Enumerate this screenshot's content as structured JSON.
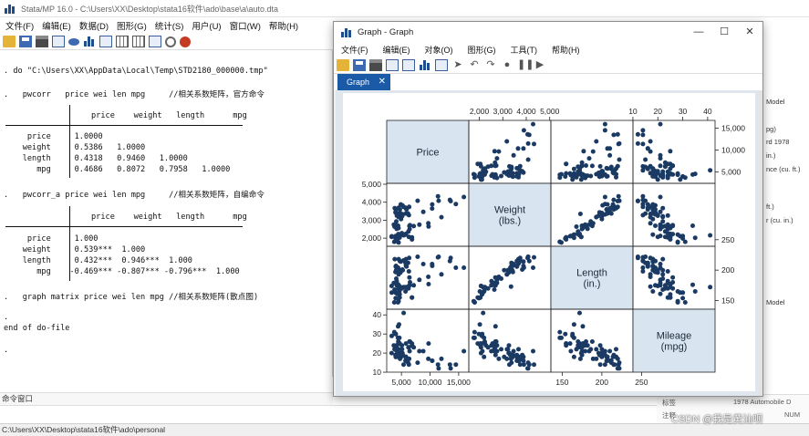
{
  "main_window": {
    "title": "Stata/MP 16.0 - C:\\Users\\XX\\Desktop\\stata16软件\\ado\\base\\a\\auto.dta",
    "menu": [
      "文件(F)",
      "编辑(E)",
      "数据(D)",
      "图形(G)",
      "统计(S)",
      "用户(U)",
      "窗口(W)",
      "帮助(H)"
    ]
  },
  "results": {
    "lines": [
      ". do \"C:\\Users\\XX\\AppData\\Local\\Temp\\STD2180_000000.tmp\"",
      ".   pwcorr   price wei len mpg     //相关系数矩阵，官方命令",
      "price    weight   length      mpg",
      "     price     1.0000",
      "    weight     0.5386   1.0000",
      "    length     0.4318   0.9460   1.0000",
      "       mpg     0.4686   0.8072   0.7958   1.0000",
      ".   pwcorr_a price wei len mpg     //相关系数矩阵，自编命令",
      "price    weight   length      mpg",
      "     price     1.000",
      "    weight     0.539***  1.000",
      "    length     0.432***  0.946***  1.000",
      "       mpg    -0.469*** -0.807*** -0.796***  1.000",
      ".   graph matrix price wei len mpg //相关系数矩阵(散点图)",
      ".",
      "end of do-file",
      "."
    ]
  },
  "command_window_label": "命令窗口",
  "statusbar": "C:\\Users\\XX\\Desktop\\stata16软件\\ado\\personal",
  "right_pane": {
    "items": [
      "Model",
      "pg)",
      "rd 1978",
      "in.)",
      "nce (cu. ft.)",
      "ft.)",
      "r (cu. in.)",
      "Model"
    ],
    "bottom_label": "标签",
    "bottom_value": "1978 Automobile D",
    "bottom_label2": "注释",
    "bottom_value2": "NUM"
  },
  "watermark": "CSDN @我是黄汕呗",
  "graph_window": {
    "title": "Graph - Graph",
    "menu": [
      "文件(F)",
      "编辑(E)",
      "对象(O)",
      "图形(G)",
      "工具(T)",
      "帮助(H)"
    ],
    "tab_label": "Graph",
    "window_buttons": [
      "—",
      "☐",
      "✕"
    ]
  },
  "chart_data": {
    "type": "scatter",
    "title": "",
    "variables": [
      {
        "label": [
          "Price"
        ],
        "range": [
          3291,
          15906
        ]
      },
      {
        "label": [
          "Weight",
          "(lbs.)"
        ],
        "range": [
          1760,
          4840
        ]
      },
      {
        "label": [
          "Length",
          "(in.)"
        ],
        "range": [
          142,
          233
        ]
      },
      {
        "label": [
          "Mileage",
          "(mpg)"
        ],
        "range": [
          12,
          41
        ]
      }
    ],
    "ticks": {
      "price": [
        5000,
        10000,
        15000
      ],
      "price_labels": [
        "5,000",
        "10,000",
        "15,000"
      ],
      "weight": [
        2000,
        3000,
        4000,
        5000
      ],
      "weight_labels": [
        "2,000",
        "3,000",
        "4,000",
        "5,000"
      ],
      "length": [
        150,
        200,
        250
      ],
      "length_labels": [
        "150",
        "200",
        "250"
      ],
      "mpg": [
        10,
        20,
        30,
        40
      ],
      "mpg_labels": [
        "10",
        "20",
        "30",
        "40"
      ]
    },
    "observations": [
      [
        4099,
        2930,
        186,
        22
      ],
      [
        4749,
        3350,
        173,
        17
      ],
      [
        3799,
        2640,
        168,
        22
      ],
      [
        4816,
        3250,
        196,
        20
      ],
      [
        7827,
        4080,
        222,
        15
      ],
      [
        5788,
        3670,
        218,
        18
      ],
      [
        4453,
        2230,
        170,
        26
      ],
      [
        5189,
        3280,
        200,
        20
      ],
      [
        10372,
        3880,
        207,
        16
      ],
      [
        4082,
        3400,
        200,
        19
      ],
      [
        11385,
        4330,
        221,
        14
      ],
      [
        14500,
        3900,
        204,
        14
      ],
      [
        15906,
        4290,
        204,
        21
      ],
      [
        3299,
        2110,
        163,
        29
      ],
      [
        5705,
        3690,
        212,
        16
      ],
      [
        4504,
        3180,
        193,
        22
      ],
      [
        5104,
        3220,
        200,
        22
      ],
      [
        3667,
        2750,
        179,
        24
      ],
      [
        3955,
        3430,
        197,
        19
      ],
      [
        3984,
        2120,
        163,
        30
      ],
      [
        4010,
        3600,
        206,
        18
      ],
      [
        5886,
        3600,
        206,
        16
      ],
      [
        6342,
        3740,
        220,
        17
      ],
      [
        4389,
        1800,
        147,
        28
      ],
      [
        4187,
        2650,
        179,
        21
      ],
      [
        11497,
        4080,
        222,
        12
      ],
      [
        13594,
        4060,
        220,
        12
      ],
      [
        13466,
        4130,
        215,
        14
      ],
      [
        3829,
        3670,
        218,
        22
      ],
      [
        5379,
        3740,
        216,
        14
      ],
      [
        6165,
        3370,
        212,
        15
      ],
      [
        4516,
        3690,
        218,
        18
      ],
      [
        6303,
        3280,
        198,
        14
      ],
      [
        3291,
        2070,
        174,
        20
      ],
      [
        8814,
        3460,
        210,
        21
      ],
      [
        5172,
        3830,
        201,
        19
      ],
      [
        4733,
        3420,
        198,
        19
      ],
      [
        4890,
        3880,
        214,
        18
      ],
      [
        4181,
        2690,
        175,
        19
      ],
      [
        4195,
        3260,
        198,
        24
      ],
      [
        10371,
        3650,
        210,
        16
      ],
      [
        4647,
        2200,
        165,
        28
      ],
      [
        4425,
        2690,
        176,
        34
      ],
      [
        4482,
        2560,
        176,
        25
      ],
      [
        6486,
        2720,
        180,
        26
      ],
      [
        4060,
        3420,
        207,
        18
      ],
      [
        5798,
        3370,
        207,
        18
      ],
      [
        4934,
        3060,
        200,
        18
      ],
      [
        5222,
        3330,
        200,
        19
      ],
      [
        4723,
        3600,
        215,
        19
      ],
      [
        4424,
        3320,
        204,
        19
      ],
      [
        4172,
        2520,
        182,
        24
      ],
      [
        9690,
        2830,
        189,
        17
      ],
      [
        6295,
        2070,
        174,
        23
      ],
      [
        9735,
        2650,
        177,
        25
      ],
      [
        6229,
        2370,
        170,
        23
      ],
      [
        4589,
        2020,
        165,
        35
      ],
      [
        5079,
        2280,
        170,
        24
      ],
      [
        8129,
        2750,
        184,
        21
      ],
      [
        4296,
        2130,
        161,
        21
      ],
      [
        5799,
        2240,
        172,
        25
      ],
      [
        4499,
        1760,
        149,
        28
      ],
      [
        3995,
        1980,
        154,
        30
      ],
      [
        3748,
        1800,
        147,
        31
      ],
      [
        5719,
        2200,
        165,
        18
      ],
      [
        7140,
        2670,
        175,
        23
      ],
      [
        5397,
        2160,
        172,
        41
      ],
      [
        4697,
        2040,
        155,
        25
      ],
      [
        6850,
        1930,
        155,
        25
      ],
      [
        11995,
        3170,
        193,
        17
      ],
      [
        6850,
        2040,
        155,
        24
      ],
      [
        4697,
        2110,
        160,
        25
      ],
      [
        6397,
        2680,
        188,
        26
      ],
      [
        6424,
        2510,
        175,
        21
      ]
    ]
  }
}
